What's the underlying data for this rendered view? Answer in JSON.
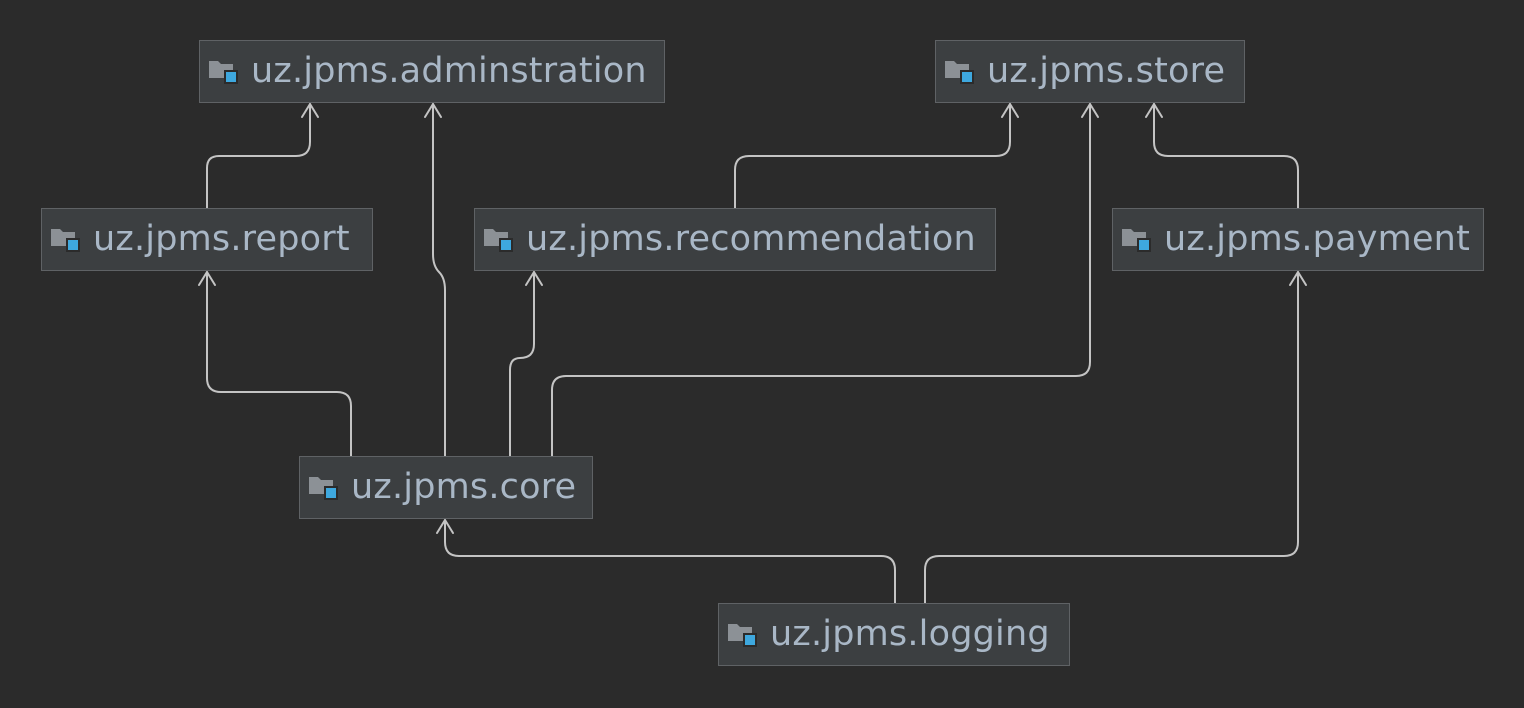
{
  "diagram": {
    "modules": {
      "administration": "uz.jpms.adminstration",
      "store": "uz.jpms.store",
      "report": "uz.jpms.report",
      "recommendation": "uz.jpms.recommendation",
      "payment": "uz.jpms.payment",
      "core": "uz.jpms.core",
      "logging": "uz.jpms.logging"
    },
    "icon": "module-package-icon",
    "dependencies": [
      {
        "from": "uz.jpms.report",
        "to": "uz.jpms.adminstration"
      },
      {
        "from": "uz.jpms.core",
        "to": "uz.jpms.adminstration"
      },
      {
        "from": "uz.jpms.recommendation",
        "to": "uz.jpms.store"
      },
      {
        "from": "uz.jpms.core",
        "to": "uz.jpms.store"
      },
      {
        "from": "uz.jpms.payment",
        "to": "uz.jpms.store"
      },
      {
        "from": "uz.jpms.core",
        "to": "uz.jpms.report"
      },
      {
        "from": "uz.jpms.core",
        "to": "uz.jpms.recommendation"
      },
      {
        "from": "uz.jpms.logging",
        "to": "uz.jpms.core"
      },
      {
        "from": "uz.jpms.logging",
        "to": "uz.jpms.payment"
      }
    ],
    "colors": {
      "background": "#2b2b2b",
      "node_fill": "#3c3f41",
      "node_border": "#5f6265",
      "text": "#a9b7c6",
      "edge": "#c4c4c4",
      "icon_folder": "#8c9196",
      "icon_badge": "#3ea8de"
    }
  }
}
